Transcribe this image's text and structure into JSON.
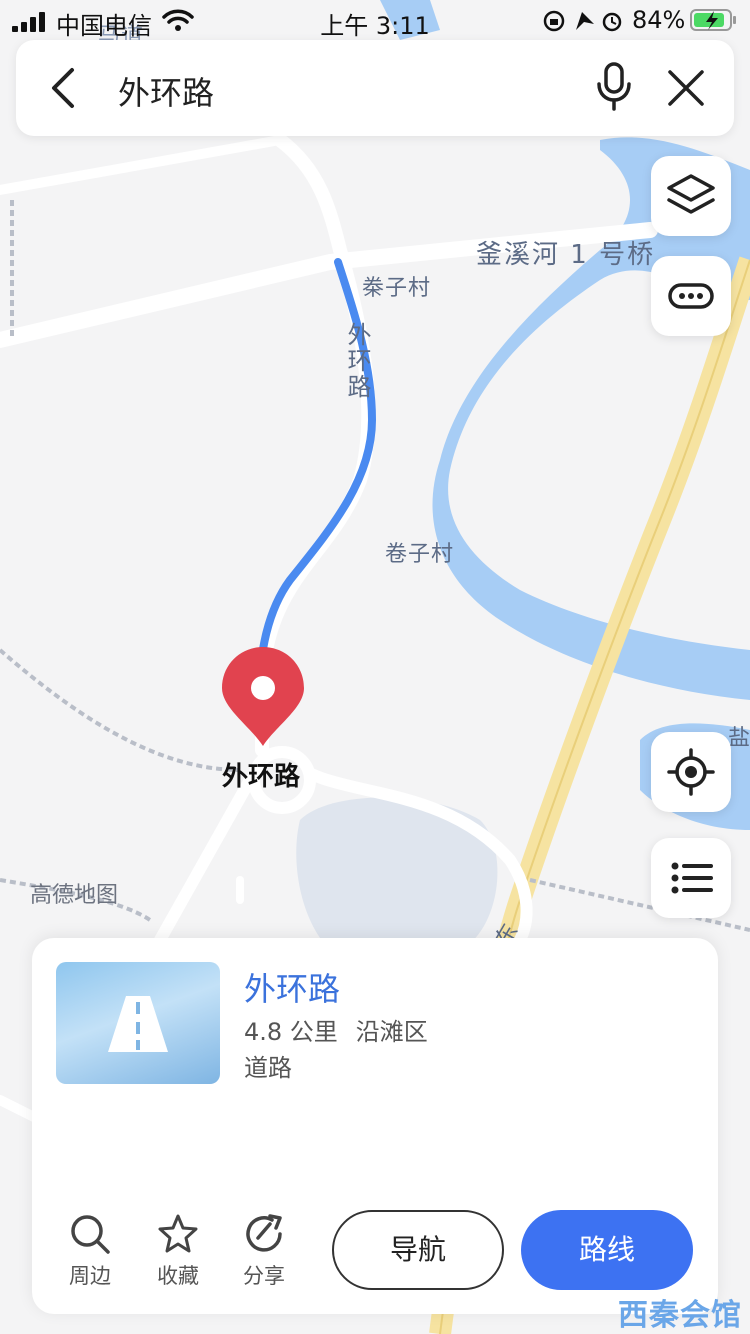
{
  "status_bar": {
    "carrier": "中国电信",
    "time": "上午 3:11",
    "battery": "84%"
  },
  "search": {
    "query": "外环路"
  },
  "map": {
    "labels": {
      "bridge": "釜溪河 1 号桥",
      "village1": "桊子村",
      "village2": "卷子村",
      "road": "外环路",
      "brand": "高德地图",
      "edge_right": "盐",
      "edge_top": "马道",
      "edge_bottom": "东"
    },
    "pin_label": "外环路"
  },
  "colors": {
    "accent": "#3d72f2",
    "title_blue": "#3b72dc",
    "route": "#4a8af0",
    "pin": "#e1434f",
    "water": "#a7cdf5",
    "highway": "#f6e3a1"
  },
  "icons": {
    "layers": "layers-icon",
    "more": "more-icon",
    "locate": "locate-icon",
    "list": "list-icon"
  },
  "card": {
    "title": "外环路",
    "distance": "4.8 公里",
    "district": "沿滩区",
    "category": "道路",
    "actions": {
      "nearby": "周边",
      "favorite": "收藏",
      "share": "分享"
    },
    "navigate_label": "导航",
    "route_label": "路线"
  },
  "watermark": "西秦会馆"
}
